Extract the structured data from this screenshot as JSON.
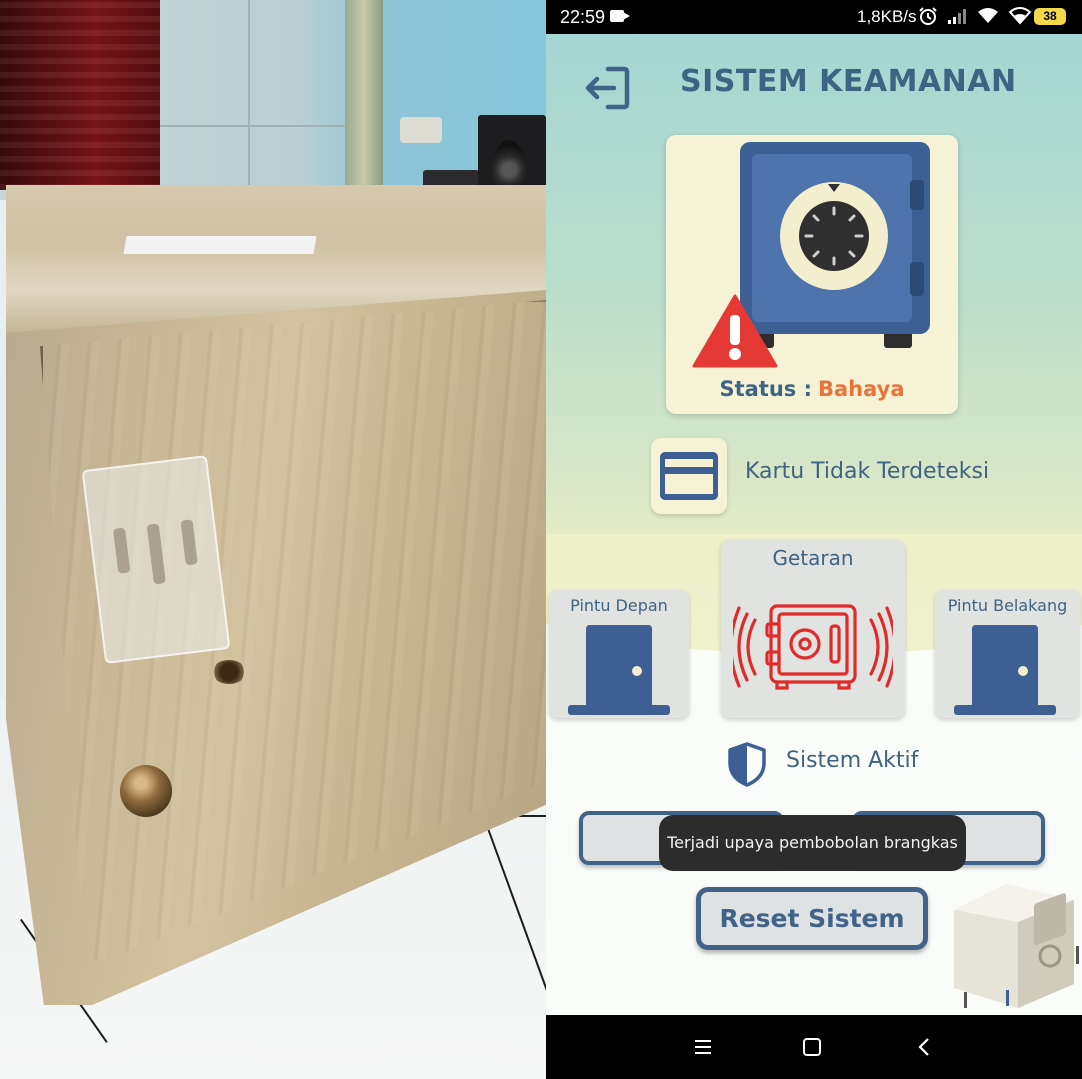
{
  "status_bar": {
    "time": "22:59",
    "net_speed": "1,8KB/s",
    "battery": "38"
  },
  "app": {
    "title": "SISTEM KEAMANAN",
    "status_label": "Status :",
    "status_value": "Bahaya",
    "card_status": "Kartu Tidak Terdeteksi",
    "sensors": {
      "front_door": "Pintu Depan",
      "vibration": "Getaran",
      "back_door": "Pintu Belakang"
    },
    "system_status": "Sistem Aktif",
    "reset_button": "Reset Sistem",
    "toast": "Terjadi upaya pembobolan brangkas"
  },
  "colors": {
    "accent_blue": "#41638a",
    "danger_orange": "#e8743a",
    "warning_red": "#e53935",
    "vibration_red": "#e02b2b"
  },
  "icons": [
    "back-arrow-icon",
    "safe-icon",
    "warning-icon",
    "credit-card-icon",
    "door-icon",
    "vibrating-safe-icon",
    "shield-icon",
    "menu-icon",
    "home-icon",
    "back-icon"
  ]
}
